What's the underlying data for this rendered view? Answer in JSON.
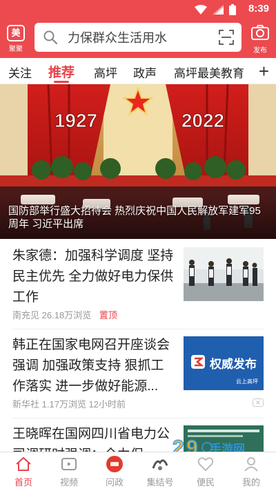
{
  "status_bar": {
    "time": "8:39"
  },
  "header": {
    "logo_caption": "聚聚",
    "logo_glyph": "美",
    "search_placeholder": "力保群众生活用水",
    "publish_label": "发布",
    "accent_color": "#ec4a4f"
  },
  "tabs": [
    {
      "label": "关注"
    },
    {
      "label": "推荐",
      "active": true
    },
    {
      "label": "高坪"
    },
    {
      "label": "政声"
    },
    {
      "label": "高坪最美教育"
    }
  ],
  "hero": {
    "year_left": "1927",
    "year_right": "2022",
    "caption": "国防部举行盛大招待会 热烈庆祝中国人民解放军建军95周年 习近平出席"
  },
  "news": [
    {
      "title": "朱家德：加强科学调度 坚持民主优先 全力做好电力保供工作",
      "source": "南充见",
      "views": "26.18万浏览",
      "pinned": "置顶"
    },
    {
      "title": "韩正在国家电网召开座谈会强调 加强政策支持 狠抓工作落实 进一步做好能源...",
      "source": "新华社",
      "views": "1.17万浏览",
      "time": "12小时前",
      "thumb_text": "权威发布",
      "thumb_sub": "云上高坪"
    },
    {
      "title": "王晓晖在国网四川省电力公司调研时强调：全力保"
    }
  ],
  "bottom_nav": [
    {
      "label": "首页",
      "active": true
    },
    {
      "label": "视频"
    },
    {
      "label": "问政"
    },
    {
      "label": "集结号"
    },
    {
      "label": "便民"
    },
    {
      "label": "我的"
    }
  ],
  "watermark": {
    "text": "手游网"
  }
}
